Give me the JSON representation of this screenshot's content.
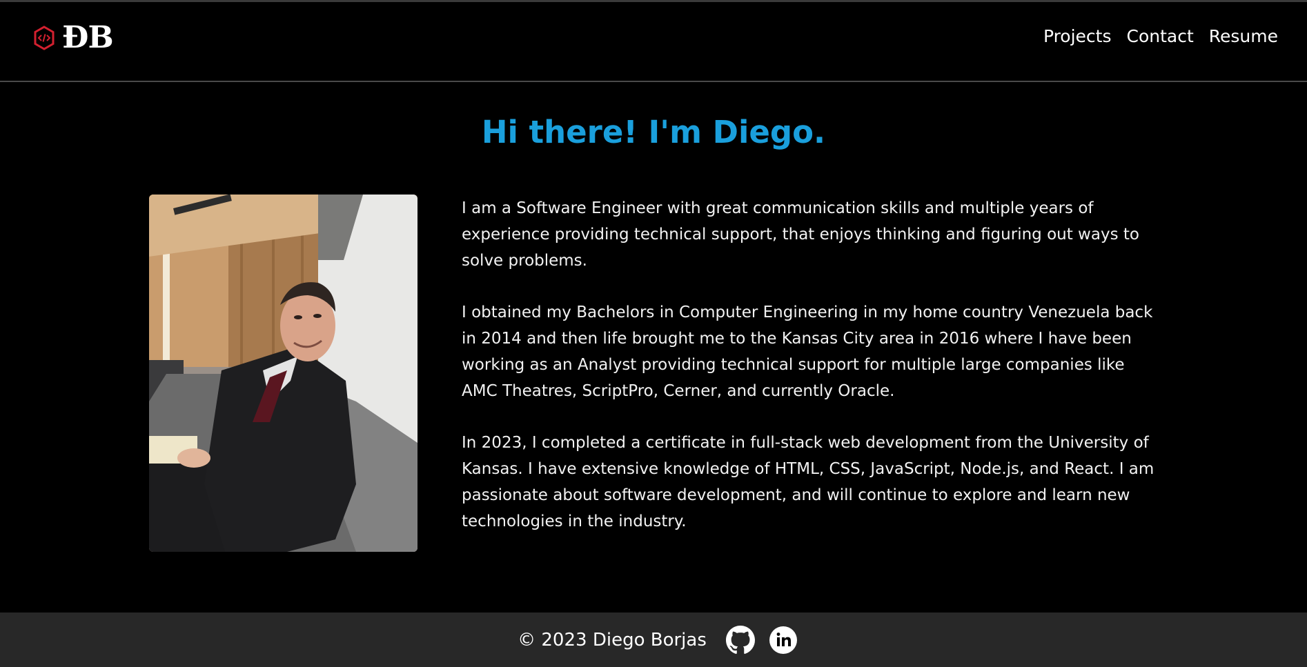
{
  "header": {
    "logo_text": "ĐB",
    "logo_icon": "code-hexagon-icon",
    "nav": [
      {
        "label": "Projects"
      },
      {
        "label": "Contact"
      },
      {
        "label": "Resume"
      }
    ]
  },
  "hero": {
    "title": "Hi there! I'm Diego."
  },
  "about": {
    "paragraphs": [
      "I am a Software Engineer with great communication skills and multiple years of experience providing technical support, that enjoys thinking and figuring out ways to solve problems.",
      "I obtained my Bachelors in Computer Engineering in my home country Venezuela back in 2014 and then life brought me to the Kansas City area in 2016 where I have been working as an Analyst providing technical support for multiple large companies like AMC Theatres, ScriptPro, Cerner, and currently Oracle.",
      "In 2023, I completed a certificate in full-stack web development from the University of Kansas. I have extensive knowledge of HTML, CSS, JavaScript, Node.js, and React. I am passionate about software development, and will continue to explore and learn new technologies in the industry."
    ]
  },
  "footer": {
    "copyright": "© 2023 Diego Borjas",
    "social": [
      {
        "icon": "github-icon"
      },
      {
        "icon": "linkedin-icon"
      }
    ]
  },
  "colors": {
    "accent": "#1a9fdc",
    "logo_red": "#d3202f",
    "background": "#000000",
    "footer_bg": "#282828"
  }
}
